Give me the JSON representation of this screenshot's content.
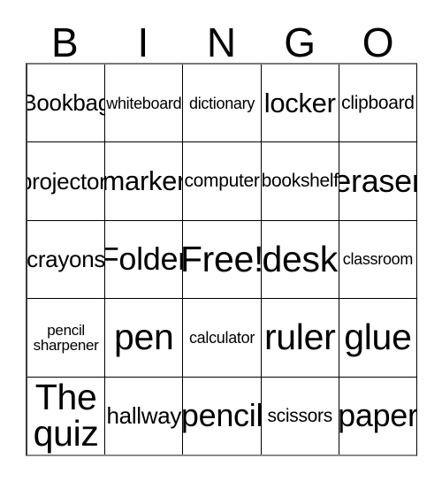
{
  "card": {
    "header_letters": [
      "B",
      "I",
      "N",
      "G",
      "O"
    ],
    "rows": [
      [
        {
          "text": "Bookbag",
          "size": "fs-20"
        },
        {
          "text": "whiteboard",
          "size": "fs-14"
        },
        {
          "text": "dictionary",
          "size": "fs-14"
        },
        {
          "text": "locker",
          "size": "fs-24"
        },
        {
          "text": "clipboard",
          "size": "fs-16"
        }
      ],
      [
        {
          "text": "projector",
          "size": "fs-20",
          "clipped": true
        },
        {
          "text": "marker",
          "size": "fs-24"
        },
        {
          "text": "computer",
          "size": "fs-16"
        },
        {
          "text": "bookshelf",
          "size": "fs-16"
        },
        {
          "text": "eraser",
          "size": "fs-28"
        }
      ],
      [
        {
          "text": "crayons",
          "size": "fs-20"
        },
        {
          "text": "Folder",
          "size": "fs-28"
        },
        {
          "text": "Free!",
          "size": "fs-32"
        },
        {
          "text": "desk",
          "size": "fs-32"
        },
        {
          "text": "classroom",
          "size": "fs-14"
        }
      ],
      [
        {
          "text": "pencil\nsharpener",
          "size": "fs-13"
        },
        {
          "text": "pen",
          "size": "fs-32"
        },
        {
          "text": "calculator",
          "size": "fs-14"
        },
        {
          "text": "ruler",
          "size": "fs-32"
        },
        {
          "text": "glue",
          "size": "fs-32"
        }
      ],
      [
        {
          "text": "The\nquiz",
          "size": "fs-32"
        },
        {
          "text": "hallway",
          "size": "fs-20"
        },
        {
          "text": "pencil",
          "size": "fs-28"
        },
        {
          "text": "scissors",
          "size": "fs-16"
        },
        {
          "text": "paper",
          "size": "fs-28"
        }
      ]
    ]
  },
  "colors": {
    "grid_line": "#000000",
    "text": "#000000",
    "background": "#ffffff"
  }
}
